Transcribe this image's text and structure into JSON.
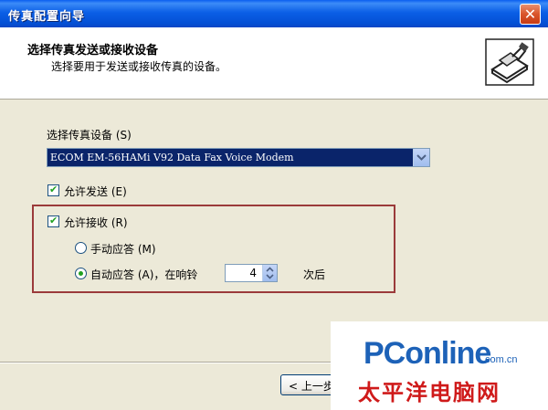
{
  "window": {
    "title": "传真配置向导",
    "close_glyph": "✕"
  },
  "header": {
    "title": "选择传真发送或接收设备",
    "subtitle": "选择要用于发送或接收传真的设备。",
    "icon": "fax-machine-icon"
  },
  "form": {
    "device_label": "选择传真设备 (S)",
    "device_value": "ECOM EM-56HAMi V92 Data Fax Voice Modem",
    "allow_send_label": "允许发送 (E)",
    "allow_send_checked": true,
    "allow_receive_label": "允许接收 (R)",
    "allow_receive_checked": true,
    "manual_answer_label": "手动应答 (M)",
    "auto_answer_label": "自动应答 (A)，在响铃",
    "answer_mode": "auto",
    "rings_value": "4",
    "rings_suffix": "次后"
  },
  "buttons": {
    "back_label": "< 上一步"
  },
  "watermark": {
    "main": "PConline",
    "suffix": ".com.cn",
    "chinese": "太平洋电脑网"
  },
  "colors": {
    "titlebar": "#0a5ef0",
    "highlight_border": "#9b3a3a",
    "check_mark": "#21a121",
    "watermark_blue": "#1d62b8",
    "watermark_red": "#cf1a1a"
  }
}
